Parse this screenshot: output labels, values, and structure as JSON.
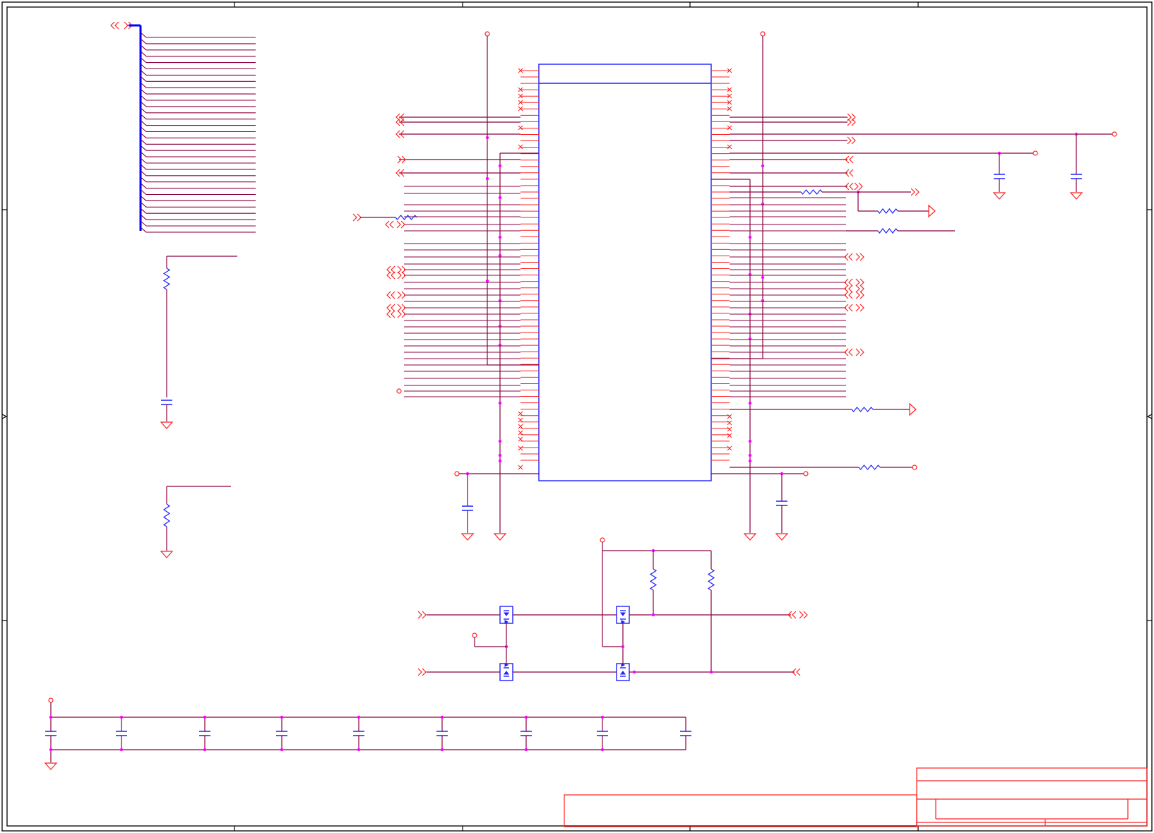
{
  "document": {
    "kind": "schematic-sheet",
    "title_block": {
      "rows_filled": []
    },
    "visible_text": []
  },
  "colors": {
    "wire": "#8B0040",
    "pin": "#ff2020",
    "part": "#1f1fff",
    "junction": "#ff00ff",
    "border": "#000000",
    "bus": "#0000ff"
  },
  "icons": {
    "offpage": "offpage-connector-icon",
    "ground": "ground-icon",
    "resistor": "resistor-icon",
    "capacitor": "capacitor-icon",
    "mosfet": "mosfet-icon",
    "power": "power-port-icon",
    "noconnect": "no-connect-icon"
  }
}
